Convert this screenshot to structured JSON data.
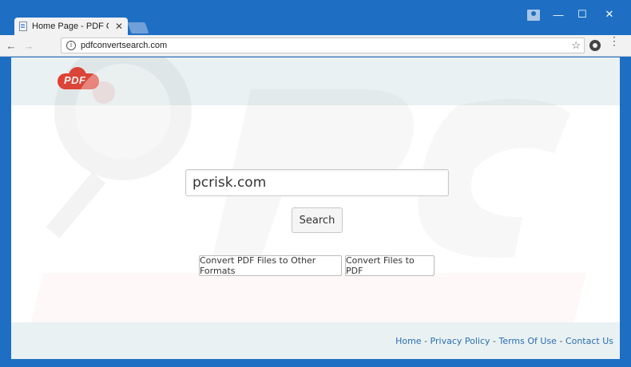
{
  "browser": {
    "tab_title": "Home Page - PDF Conve",
    "url": "pdfconvertsearch.com",
    "info_glyph": "i",
    "close_glyph": "✕",
    "back_glyph": "←",
    "forward_glyph": "→",
    "minimize_glyph": "—",
    "maximize_glyph": "☐",
    "star_glyph": "☆",
    "menu_glyph": "⋮"
  },
  "logo": {
    "text": "PDF"
  },
  "search": {
    "value": "pcrisk.com",
    "button_label": "Search"
  },
  "convert": {
    "button1_label": "Convert PDF Files to Other Formats",
    "button2_label": "Convert Files to PDF"
  },
  "footer": {
    "links": [
      "Home",
      "Privacy Policy",
      "Terms Of Use",
      "Contact Us"
    ],
    "separator": " - "
  },
  "colors": {
    "titlebar": "#1e6fc3",
    "logo_red": "#e53d2f",
    "band": "#e9f1f3",
    "link": "#2c6eb0"
  }
}
